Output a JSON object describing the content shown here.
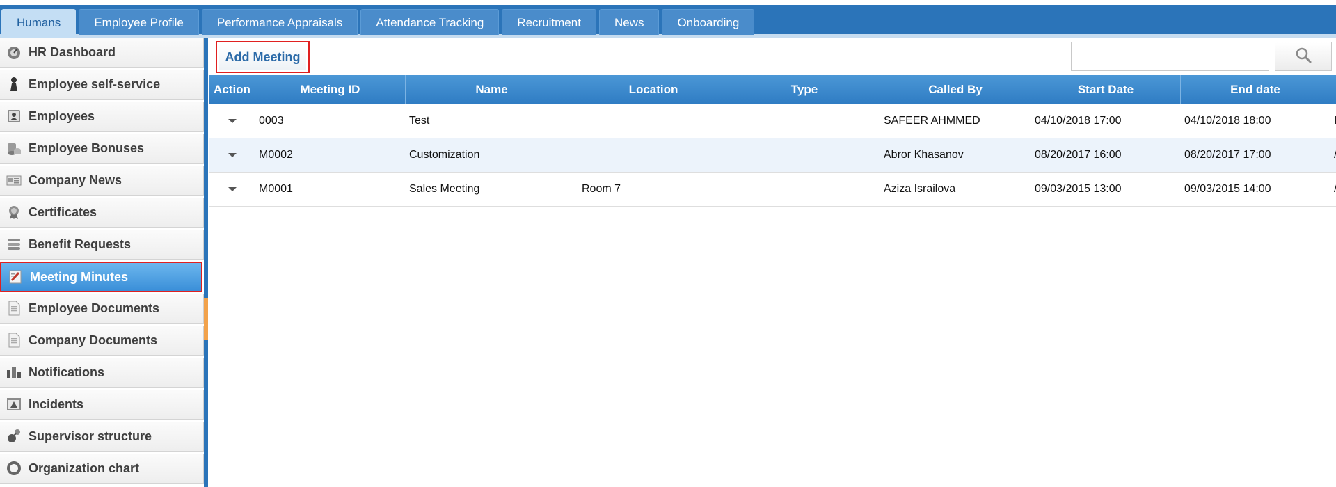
{
  "tabs": [
    {
      "label": "Humans",
      "active": true
    },
    {
      "label": "Employee Profile",
      "active": false
    },
    {
      "label": "Performance Appraisals",
      "active": false
    },
    {
      "label": "Attendance Tracking",
      "active": false
    },
    {
      "label": "Recruitment",
      "active": false
    },
    {
      "label": "News",
      "active": false
    },
    {
      "label": "Onboarding",
      "active": false
    }
  ],
  "sidebar": {
    "items": [
      {
        "label": "HR Dashboard",
        "icon": "dashboard-icon"
      },
      {
        "label": "Employee self-service",
        "icon": "person-icon"
      },
      {
        "label": "Employees",
        "icon": "employee-card-icon"
      },
      {
        "label": "Employee Bonuses",
        "icon": "coins-icon"
      },
      {
        "label": "Company News",
        "icon": "newspaper-icon"
      },
      {
        "label": "Certificates",
        "icon": "award-icon"
      },
      {
        "label": "Benefit Requests",
        "icon": "stack-icon"
      },
      {
        "label": "Meeting Minutes",
        "icon": "notepad-icon",
        "active": true
      },
      {
        "label": "Employee Documents",
        "icon": "document-icon"
      },
      {
        "label": "Company Documents",
        "icon": "document-icon"
      },
      {
        "label": "Notifications",
        "icon": "bell-icon"
      },
      {
        "label": "Incidents",
        "icon": "warning-icon"
      },
      {
        "label": "Supervisor structure",
        "icon": "hierarchy-icon"
      },
      {
        "label": "Organization chart",
        "icon": "ring-icon"
      }
    ]
  },
  "toolbar": {
    "add_label": "Add Meeting",
    "search_placeholder": ""
  },
  "grid": {
    "columns": [
      "Action",
      "Meeting ID",
      "Name",
      "Location",
      "Type",
      "Called By",
      "Start Date",
      "End date"
    ],
    "rows": [
      {
        "id": "0003",
        "name": "Test",
        "location": "",
        "type": "",
        "called_by": "SAFEER AHMMED",
        "start": "04/10/2018 17:00",
        "end": "04/10/2018 18:00",
        "extra": "I"
      },
      {
        "id": "M0002",
        "name": "Customization",
        "location": "",
        "type": "",
        "called_by": "Abror Khasanov",
        "start": "08/20/2017 16:00",
        "end": "08/20/2017 17:00",
        "extra": "/"
      },
      {
        "id": "M0001",
        "name": "Sales Meeting",
        "location": "Room 7",
        "type": "",
        "called_by": "Aziza Israilova",
        "start": "09/03/2015 13:00",
        "end": "09/03/2015 14:00",
        "extra": "/"
      }
    ]
  },
  "colors": {
    "brand": "#2b74b9",
    "active_item": "#3a8fd8",
    "highlight": "#e02020"
  }
}
